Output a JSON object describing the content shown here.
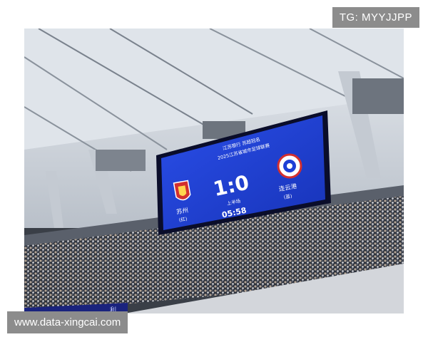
{
  "watermarks": {
    "telegram": "TG: MYYJJPP",
    "website": "www.data-xingcai.com"
  },
  "scoreboard": {
    "header_line1": "江苏银行 苏超冠名",
    "header_line2": "2025江苏省城市足球联赛",
    "home_team": "苏州",
    "home_side": "(红)",
    "away_team": "连云港",
    "away_side": "(蓝)",
    "score": "1:0",
    "period": "上半场",
    "clock": "05:58"
  },
  "colors": {
    "screen_blue": "#1e3fd6",
    "screen_frame": "#0a0d2a",
    "roof": "#d8dde4",
    "crowd": "#2b2f3a"
  }
}
